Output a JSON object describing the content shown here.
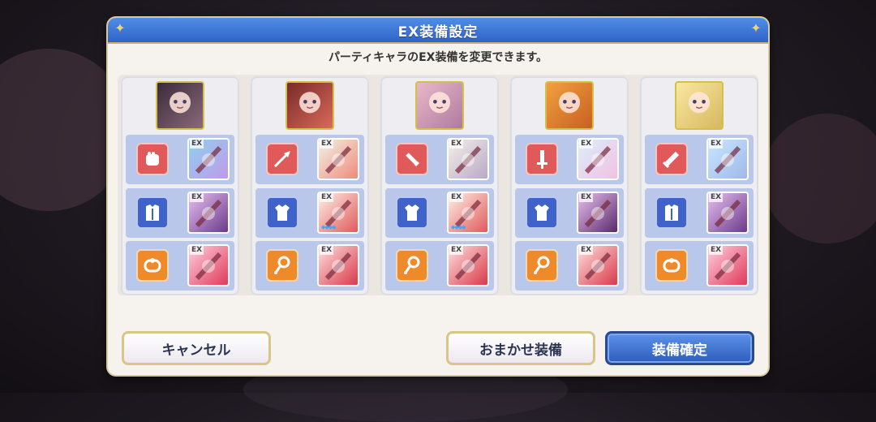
{
  "dialog": {
    "title": "EX装備設定",
    "subtitle": "パーティキャラのEX装備を変更できます。"
  },
  "ex_label": "EX",
  "characters": [
    {
      "portrait_icon": "dark-haired-character-portrait-icon",
      "slots": [
        {
          "type_icon": "fist-icon",
          "item_icon": "ex-claw-weapon-icon"
        },
        {
          "type_icon": "heavy-armor-icon",
          "item_icon": "ex-dark-armor-icon"
        },
        {
          "type_icon": "ring-icon",
          "item_icon": "ex-red-ring-accessory-icon"
        }
      ]
    },
    {
      "portrait_icon": "red-haired-character-portrait-icon",
      "slots": [
        {
          "type_icon": "spear-icon",
          "item_icon": "ex-trident-weapon-icon"
        },
        {
          "type_icon": "light-armor-icon",
          "item_icon": "ex-red-white-robe-icon"
        },
        {
          "type_icon": "necklace-icon",
          "item_icon": "ex-red-chain-accessory-icon"
        }
      ]
    },
    {
      "portrait_icon": "pink-haired-character-portrait-icon",
      "slots": [
        {
          "type_icon": "dagger-icon",
          "item_icon": "ex-lance-weapon-icon"
        },
        {
          "type_icon": "light-armor-icon",
          "item_icon": "ex-red-white-robe-icon"
        },
        {
          "type_icon": "necklace-icon",
          "item_icon": "ex-red-chain-accessory-icon"
        }
      ]
    },
    {
      "portrait_icon": "orange-haired-character-portrait-icon",
      "slots": [
        {
          "type_icon": "sword-icon",
          "item_icon": "ex-crystal-sword-icon"
        },
        {
          "type_icon": "light-armor-icon",
          "item_icon": "ex-dark-dress-icon"
        },
        {
          "type_icon": "necklace-icon",
          "item_icon": "ex-red-chain-accessory-icon"
        }
      ]
    },
    {
      "portrait_icon": "blonde-character-portrait-icon",
      "slots": [
        {
          "type_icon": "greatsword-icon",
          "item_icon": "ex-greatsword-weapon-icon"
        },
        {
          "type_icon": "heavy-armor-icon",
          "item_icon": "ex-dark-armor-icon"
        },
        {
          "type_icon": "ring-icon",
          "item_icon": "ex-red-ring-accessory-icon"
        }
      ]
    }
  ],
  "buttons": {
    "cancel": "キャンセル",
    "auto_equip": "おまかせ装備",
    "confirm": "装備確定"
  }
}
